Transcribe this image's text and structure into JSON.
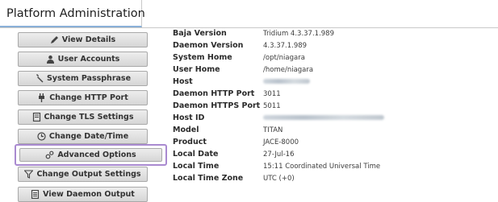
{
  "header": {
    "tab_title": "Platform Administration"
  },
  "sidebar": {
    "buttons": [
      {
        "label": "View Details",
        "icon": "pencil-icon"
      },
      {
        "label": "User Accounts",
        "icon": "user-icon"
      },
      {
        "label": "System Passphrase",
        "icon": "wrench-icon"
      },
      {
        "label": "Change HTTP Port",
        "icon": "plug-icon"
      },
      {
        "label": "Change TLS Settings",
        "icon": "certificate-icon"
      },
      {
        "label": "Change Date/Time",
        "icon": "clock-icon"
      },
      {
        "label": "Advanced Options",
        "icon": "gears-icon",
        "selected": true
      },
      {
        "label": "Change Output Settings",
        "icon": "filter-icon"
      },
      {
        "label": "View Daemon Output",
        "icon": "document-icon"
      }
    ]
  },
  "details": {
    "rows": [
      {
        "key": "Baja Version",
        "value": "Tridium 4.3.37.1.989"
      },
      {
        "key": "Daemon Version",
        "value": "4.3.37.1.989"
      },
      {
        "key": "System Home",
        "value": "/opt/niagara"
      },
      {
        "key": "User Home",
        "value": "/home/niagara"
      },
      {
        "key": "Host",
        "value": "",
        "redacted": true
      },
      {
        "key": "Daemon HTTP Port",
        "value": "3011"
      },
      {
        "key": "Daemon HTTPS Port",
        "value": "5011"
      },
      {
        "key": "Host ID",
        "value": "",
        "redacted": true
      },
      {
        "key": "Model",
        "value": "TITAN"
      },
      {
        "key": "Product",
        "value": "JACE-8000"
      },
      {
        "key": "Local Date",
        "value": "27-Jul-16"
      },
      {
        "key": "Local Time",
        "value": "15:11 Coordinated Universal Time"
      },
      {
        "key": "Local Time Zone",
        "value": "UTC (+0)"
      }
    ]
  },
  "colors": {
    "selection_outline": "#a98ad0",
    "tab_underline": "#8ab0d8",
    "button_face": "#e2e2e2"
  }
}
